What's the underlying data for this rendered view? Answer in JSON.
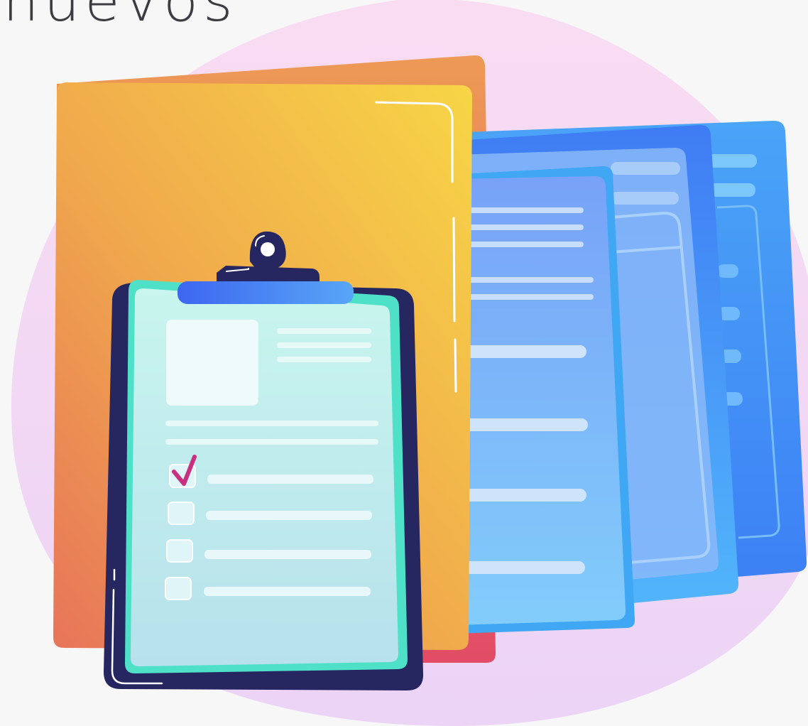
{
  "heading": "nuevos",
  "illustration": {
    "subject": "clipboard-checklist-with-documents",
    "checklist_state": [
      true,
      false,
      false,
      false
    ],
    "colors": {
      "blob": "#f4d4ef",
      "folder": "#f2b54a",
      "clipboard_frame": "#262660",
      "clip_bar": "#4d8cf7",
      "paper": "#c6f2ef",
      "documents": "#67a3f6",
      "checkmark": "#c9307f"
    }
  }
}
